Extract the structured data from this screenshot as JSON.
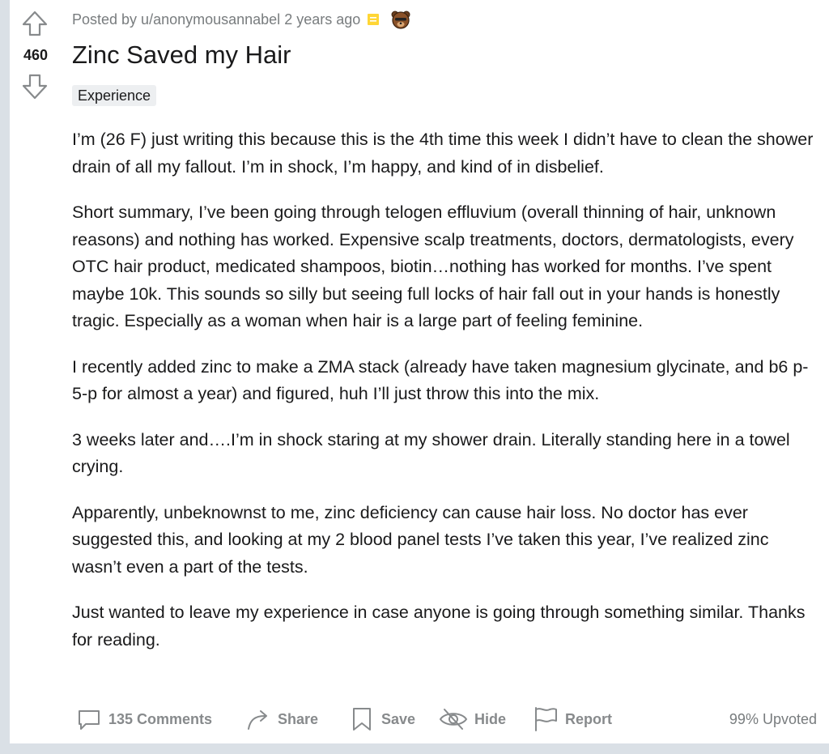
{
  "post": {
    "score": "460",
    "posted_by": "Posted by u/anonymousannabel",
    "age": "2 years ago",
    "title": "Zinc Saved my Hair",
    "flair": "Experience",
    "paragraphs": [
      "I’m (26 F) just writing this because this is the 4th time this week I didn’t have to clean the shower drain of all my fallout. I’m in shock, I’m happy, and kind of in disbelief.",
      "Short summary, I’ve been going through telogen effluvium (overall thinning of hair, unknown reasons) and nothing has worked. Expensive scalp treatments, doctors, dermatologists, every OTC hair product, medicated shampoos, biotin…nothing has worked for months. I’ve spent maybe 10k. This sounds so silly but seeing full locks of hair fall out in your hands is honestly tragic. Especially as a woman when hair is a large part of feeling feminine.",
      "I recently added zinc to make a ZMA stack (already have taken magnesium glycinate, and b6 p-5-p for almost a year) and figured, huh I’ll just throw this into the mix.",
      "3 weeks later and….I’m in shock staring at my shower drain. Literally standing here in a towel crying.",
      "Apparently, unbeknownst to me, zinc deficiency can cause hair loss. No doctor has ever suggested this, and looking at my 2 blood panel tests I’ve taken this year, I’ve realized zinc wasn’t even a part of the tests.",
      "Just wanted to leave my experience in case anyone is going through something similar. Thanks for reading."
    ]
  },
  "actions": {
    "comments": "135 Comments",
    "share": "Share",
    "save": "Save",
    "hide": "Hide",
    "report": "Report",
    "upvoted": "99% Upvoted"
  },
  "icons": {
    "upvote": "arrow-up-icon",
    "downvote": "arrow-down-icon",
    "award": "award-icon",
    "bear": "bear-award-icon",
    "comments": "comment-bubble-icon",
    "share": "share-arrow-icon",
    "save": "bookmark-icon",
    "hide": "eye-slash-icon",
    "report": "flag-icon"
  },
  "colors": {
    "background": "#dae0e6",
    "card": "#ffffff",
    "muted_text": "#787c7e",
    "action_text": "#878a8c",
    "award_yellow": "#ffd635"
  }
}
